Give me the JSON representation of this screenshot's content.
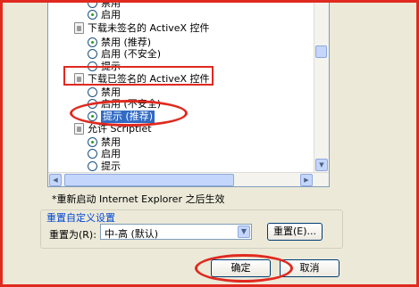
{
  "tree": {
    "items": [
      {
        "type": "radio",
        "label": "禁用",
        "checked": false
      },
      {
        "type": "radio",
        "label": "启用",
        "checked": true
      },
      {
        "type": "group",
        "label": "下载未签名的 ActiveX 控件"
      },
      {
        "type": "radio",
        "label": "禁用 (推荐)",
        "checked": true
      },
      {
        "type": "radio",
        "label": "启用 (不安全)",
        "checked": false
      },
      {
        "type": "radio",
        "label": "提示",
        "checked": false
      },
      {
        "type": "group",
        "label": "下载已签名的 ActiveX 控件"
      },
      {
        "type": "radio",
        "label": "禁用",
        "checked": false
      },
      {
        "type": "radio",
        "label": "启用 (不安全)",
        "checked": false
      },
      {
        "type": "radio",
        "label": "提示 (推荐)",
        "checked": true
      },
      {
        "type": "group",
        "label": "允许 Scriptlet"
      },
      {
        "type": "radio",
        "label": "禁用",
        "checked": true
      },
      {
        "type": "radio",
        "label": "启用",
        "checked": false
      },
      {
        "type": "radio",
        "label": "提示",
        "checked": false
      }
    ]
  },
  "note": "*重新启动 Internet Explorer 之后生效",
  "reset_group": {
    "title": "重置自定义设置",
    "label": "重置为(R):",
    "select_value": "中-高 (默认)",
    "reset_button": "重置(E)..."
  },
  "buttons": {
    "ok": "确定",
    "cancel": "取消"
  },
  "colors": {
    "highlight": "#e0291f",
    "selection": "#316ac5",
    "group_title": "#0046d5"
  }
}
